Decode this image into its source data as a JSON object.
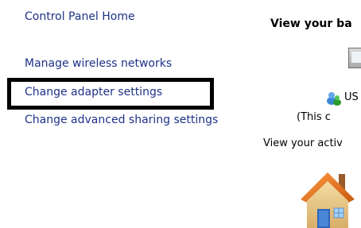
{
  "tasks": {
    "home": "Control Panel Home",
    "wireless": "Manage wireless networks",
    "adapter": "Change adapter settings",
    "sharing": "Change advanced sharing settings"
  },
  "main": {
    "heading": "View your ba",
    "user_label": "US",
    "user_sub": "(This c",
    "active_text": "View your activ"
  },
  "icons": {
    "computer": "computer-icon",
    "user": "network-user-icon",
    "house": "home-network-icon"
  },
  "colors": {
    "link": "#1e3287",
    "highlight_border": "#000000",
    "text": "#000000"
  }
}
